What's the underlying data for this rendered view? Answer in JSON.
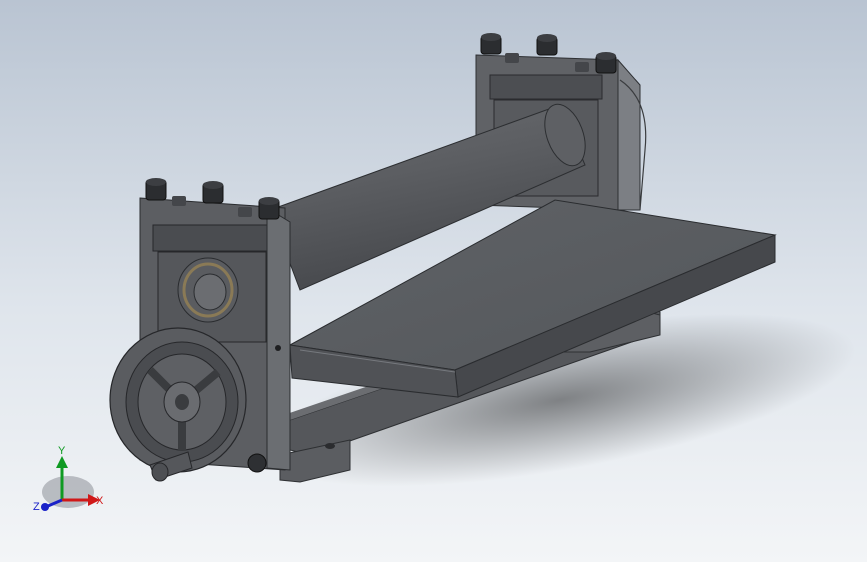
{
  "viewport": {
    "background_top": "#b9c4d2",
    "background_bottom": "#f3f5f7"
  },
  "model": {
    "body_color": "#5f6165",
    "dark_color": "#3b3d41",
    "light_color": "#8a8c90",
    "bearing_ring_color": "#8a7a56"
  },
  "triad": {
    "x_label": "X",
    "y_label": "Y",
    "z_label": "Z",
    "x_color": "#d01818",
    "y_color": "#0f9a22",
    "z_color": "#1a22c8"
  }
}
